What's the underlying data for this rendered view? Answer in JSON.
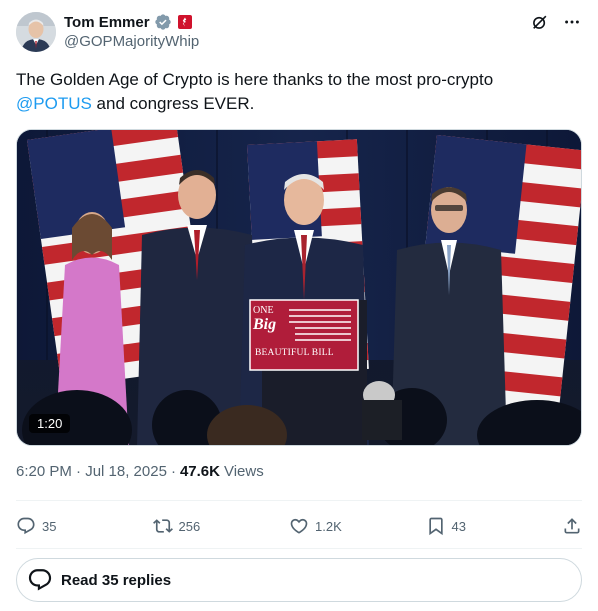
{
  "author": {
    "name": "Tom Emmer",
    "handle": "@GOPMajorityWhip"
  },
  "tweet": {
    "text_before": "The Golden Age of Crypto is here thanks to the most pro-crypto",
    "mention": "@POTUS",
    "text_after": " and congress EVER."
  },
  "media": {
    "duration": "1:20",
    "podium_line1": "ONE",
    "podium_line2": "Big",
    "podium_line3": "BEAUTIFUL BILL"
  },
  "meta": {
    "timestamp": "6:20 PM · Jul 18, 2025",
    "separator": "·",
    "views_count": "47.6K",
    "views_label": "Views"
  },
  "actions": {
    "replies": "35",
    "reposts": "256",
    "likes": "1.2K",
    "bookmarks": "43"
  },
  "read_replies_label": "Read 35 replies",
  "colors": {
    "accent": "#1d9bf0",
    "text": "#0f1419",
    "muted": "#536471",
    "border": "#cfd9de"
  }
}
